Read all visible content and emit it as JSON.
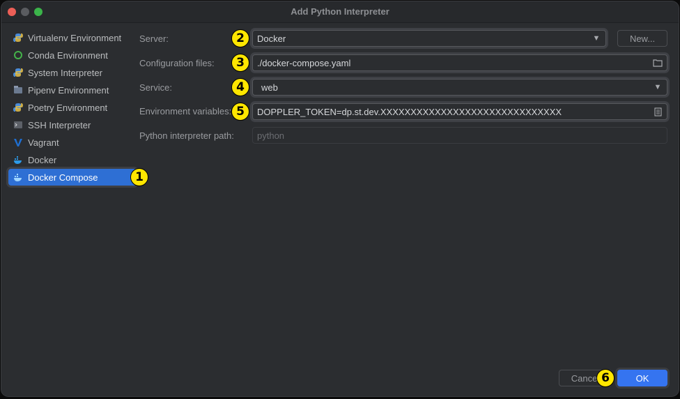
{
  "window": {
    "title": "Add Python Interpreter"
  },
  "sidebar": {
    "items": [
      {
        "label": "Virtualenv Environment",
        "icon": "python-icon"
      },
      {
        "label": "Conda Environment",
        "icon": "conda-icon"
      },
      {
        "label": "System Interpreter",
        "icon": "python-icon"
      },
      {
        "label": "Pipenv Environment",
        "icon": "pipenv-icon"
      },
      {
        "label": "Poetry Environment",
        "icon": "python-icon"
      },
      {
        "label": "SSH Interpreter",
        "icon": "terminal-icon"
      },
      {
        "label": "Vagrant",
        "icon": "vagrant-icon"
      },
      {
        "label": "Docker",
        "icon": "docker-icon"
      },
      {
        "label": "Docker Compose",
        "icon": "docker-icon",
        "selected": true
      }
    ]
  },
  "form": {
    "server_label": "Server:",
    "server_value": "Docker",
    "new_button": "New...",
    "config_label": "Configuration files:",
    "config_value": "./docker-compose.yaml",
    "service_label": "Service:",
    "service_value": "web",
    "env_label": "Environment variables:",
    "env_value": "DOPPLER_TOKEN=dp.st.dev.XXXXXXXXXXXXXXXXXXXXXXXXXXXXXX",
    "path_label": "Python interpreter path:",
    "path_placeholder": "python"
  },
  "footer": {
    "cancel_label": "Cancel",
    "ok_label": "OK"
  },
  "badges": [
    "1",
    "2",
    "3",
    "4",
    "5",
    "6"
  ],
  "colors": {
    "accent": "#3574f0",
    "selected": "#2e6fd4",
    "badge": "#ffe600"
  }
}
